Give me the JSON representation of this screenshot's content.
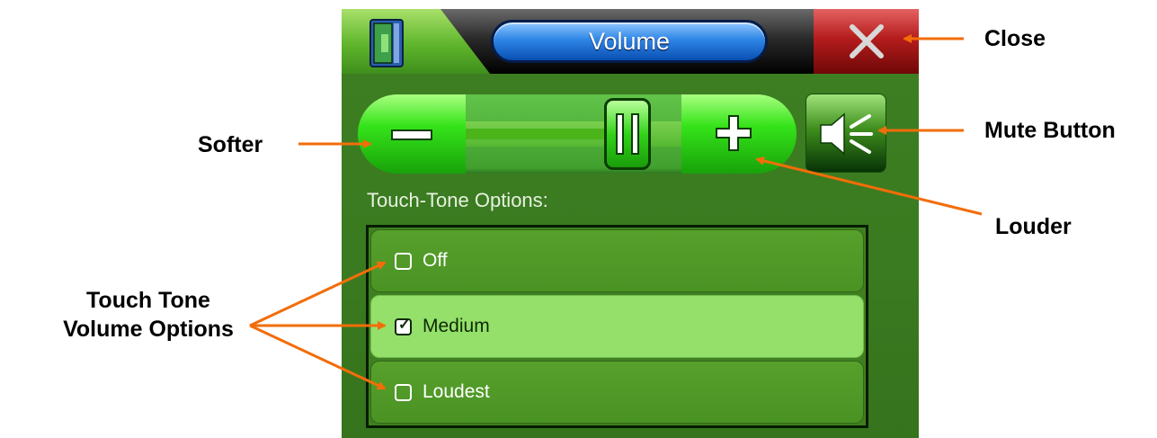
{
  "window": {
    "title": "Volume",
    "close_icon": "close-x-icon",
    "app_icon": "book-door-icon"
  },
  "volume": {
    "level": 0.75,
    "minus_icon": "minus-icon",
    "plus_icon": "plus-icon",
    "mute_icon": "speaker-mute-icon"
  },
  "touch_tone": {
    "label": "Touch-Tone Options:",
    "options": [
      {
        "label": "Off",
        "checked": false
      },
      {
        "label": "Medium",
        "checked": true
      },
      {
        "label": "Loudest",
        "checked": false
      }
    ]
  },
  "annotations": {
    "close": "Close",
    "mute": "Mute Button",
    "softer": "Softer",
    "louder": "Louder",
    "touch_tone_line1": "Touch Tone",
    "touch_tone_line2": "Volume Options"
  },
  "colors": {
    "arrow": "#f26d0a",
    "background": "#3a7a20",
    "accent_green": "#35e319",
    "title_blue": "#2f86e6",
    "close_red": "#b51d1d"
  }
}
